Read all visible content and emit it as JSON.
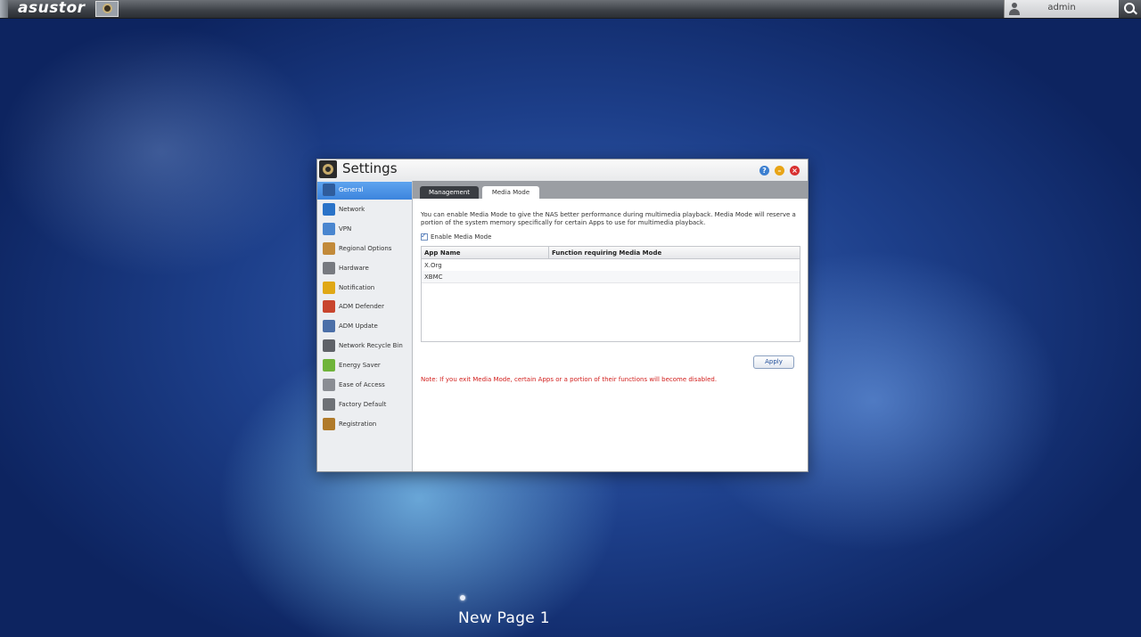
{
  "topbar": {
    "logo": "asustor",
    "user": "admin"
  },
  "window": {
    "title": "Settings"
  },
  "sidebar": {
    "items": [
      {
        "label": "General",
        "icon": "general-icon",
        "color": "#2f5c9c"
      },
      {
        "label": "Network",
        "icon": "network-icon",
        "color": "#2a73c8"
      },
      {
        "label": "VPN",
        "icon": "vpn-icon",
        "color": "#4a86cf"
      },
      {
        "label": "Regional Options",
        "icon": "clock-icon",
        "color": "#c28a3a"
      },
      {
        "label": "Hardware",
        "icon": "hardware-icon",
        "color": "#777a80"
      },
      {
        "label": "Notification",
        "icon": "warning-icon",
        "color": "#e0a816"
      },
      {
        "label": "ADM Defender",
        "icon": "firewall-icon",
        "color": "#c8452e"
      },
      {
        "label": "ADM Update",
        "icon": "update-icon",
        "color": "#4b6fa8"
      },
      {
        "label": "Network Recycle Bin",
        "icon": "recycle-bin-icon",
        "color": "#5f6268"
      },
      {
        "label": "Energy Saver",
        "icon": "energy-icon",
        "color": "#6fb43a"
      },
      {
        "label": "Ease of Access",
        "icon": "ease-of-access-icon",
        "color": "#8a8d93"
      },
      {
        "label": "Factory Default",
        "icon": "undo-icon",
        "color": "#6e7176"
      },
      {
        "label": "Registration",
        "icon": "registration-icon",
        "color": "#b07a2a"
      }
    ]
  },
  "tabs": {
    "management": "Management",
    "media_mode": "Media Mode"
  },
  "media_mode": {
    "description": "You can enable Media Mode to give the NAS better performance during multimedia playback. Media Mode will reserve a portion of the system memory specifically for certain Apps to use for multimedia playback.",
    "enable_label": "Enable Media Mode",
    "enable_checked": true,
    "columns": [
      "App Name",
      "Function requiring Media Mode"
    ],
    "rows": [
      {
        "app": "X.Org",
        "function": ""
      },
      {
        "app": "XBMC",
        "function": ""
      }
    ],
    "apply_label": "Apply",
    "note": "Note: If you exit Media Mode, certain Apps or a portion of their functions will become disabled."
  },
  "desktop": {
    "page_label": "New Page 1"
  }
}
